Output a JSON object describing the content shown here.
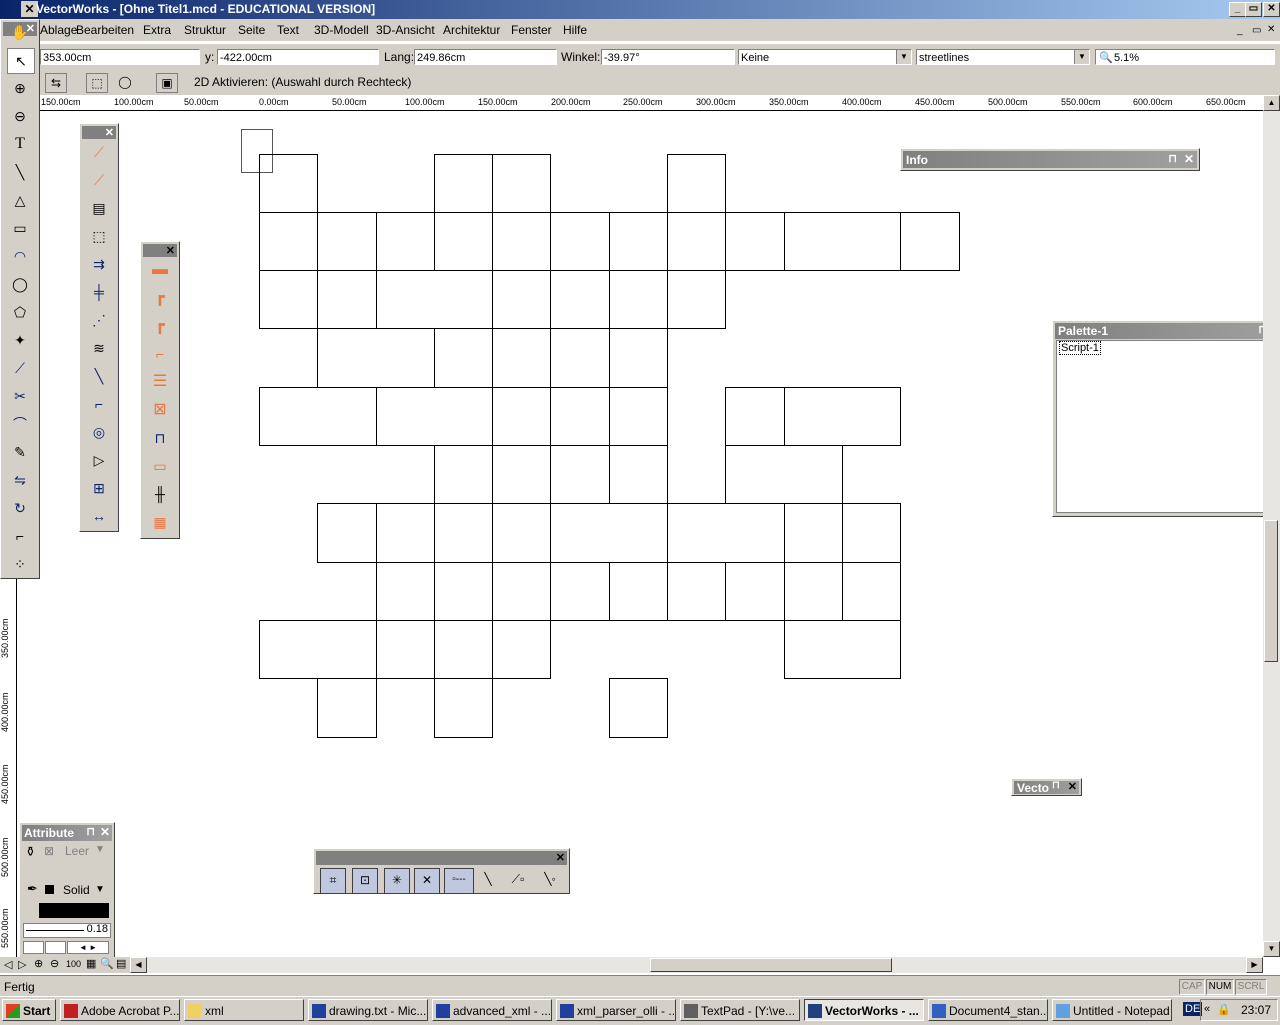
{
  "window": {
    "title": "VectorWorks - [Ohne Titel1.mcd - EDUCATIONAL VERSION]"
  },
  "menu": [
    "Ablage",
    "Bearbeiten",
    "Extra",
    "Struktur",
    "Seite",
    "Text",
    "3D-Modell",
    "3D-Ansicht",
    "Architektur",
    "Fenster",
    "Hilfe"
  ],
  "data_bar": {
    "x_value": "353.00cm",
    "y_label": "y:",
    "y_value": "-422.00cm",
    "length_label": "Lang:",
    "length_value": "249.86cm",
    "angle_label": "Winkel:",
    "angle_value": "-39.97°",
    "class_value": "Keine",
    "layer_value": "streetlines",
    "zoom_value": "5.1%"
  },
  "mode_bar": {
    "hint": "2D Aktivieren: (Auswahl durch Rechteck)"
  },
  "ruler_h": [
    "150.00cm",
    "100.00cm",
    "50.00cm",
    "0.00cm",
    "50.00cm",
    "100.00cm",
    "150.00cm",
    "200.00cm",
    "250.00cm",
    "300.00cm",
    "350.00cm",
    "400.00cm",
    "450.00cm",
    "500.00cm",
    "550.00cm",
    "600.00cm",
    "650.00cm"
  ],
  "ruler_v": [
    "350.00cm",
    "400.00cm",
    "450.00cm",
    "500.00cm",
    "550.00cm"
  ],
  "panels": {
    "info_title": "Info",
    "palette_title": "Palette-1",
    "palette_item": "Script-1",
    "vecto_title": "Vecto",
    "attribute_title": "Attribute",
    "fill_value": "Leer",
    "pen_value": "Solid",
    "line_weight": "0.18",
    "zoom_100": "100"
  },
  "status": {
    "text": "Fertig",
    "indicators": [
      "CAP",
      "NUM",
      "SCRL"
    ]
  },
  "taskbar": {
    "start": "Start",
    "tasks": [
      "Adobe Acrobat P...",
      "xml",
      "drawing.txt - Mic...",
      "advanced_xml - ...",
      "xml_parser_olli - ...",
      "TextPad - [Y:\\ve...",
      "VectorWorks - ...",
      "Document4_stan...",
      "Untitled - Notepad"
    ],
    "lang": "DE",
    "clock": "23:07"
  },
  "colors": {
    "accent": "#0a246a",
    "object_orange": "#e87840",
    "chrome": "#d4d0c8"
  }
}
